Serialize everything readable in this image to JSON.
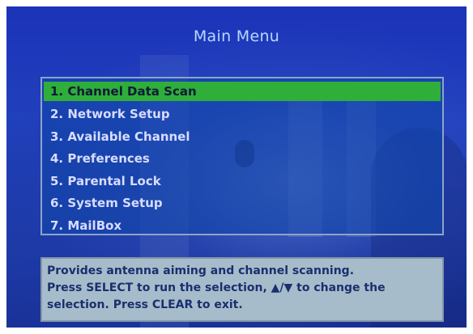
{
  "title": "Main Menu",
  "menu": {
    "items": [
      "1. Channel Data Scan",
      "2. Network Setup",
      "3. Available Channel",
      "4. Preferences",
      "5. Parental Lock",
      "6. System Setup",
      "7. MailBox"
    ],
    "selected_index": 0
  },
  "help": {
    "lines": [
      " Provides antenna aiming and channel scanning.",
      " Press SELECT to run the selection, ▲/▼ to change the",
      "selection.  Press CLEAR to exit."
    ]
  },
  "colors": {
    "background": "#1f3cbc",
    "title": "#b9d7ff",
    "selection": "#2fae3a",
    "help_panel": "#a7bccb",
    "help_text": "#1a2f6e"
  }
}
